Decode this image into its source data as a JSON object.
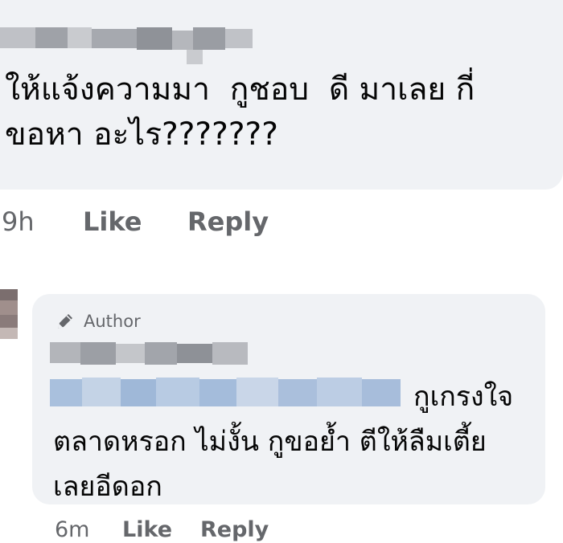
{
  "top_comment": {
    "text": "ให้แจ้งความมา  กูชอบ  ดี มาเลย กี่ ขอหา อะไร???????",
    "time": "9h",
    "like_label": "Like",
    "reply_label": "Reply"
  },
  "reply_comment": {
    "badge_icon": "pencil-icon",
    "badge_label": "Author",
    "text": "กูเกรงใจ ตลาดหรอก  ไม่งั้น กูขอย้ำ ตีให้ลืมเตี้ย เลยอีดอก",
    "time": "6m",
    "like_label": "Like",
    "reply_label": "Reply"
  }
}
